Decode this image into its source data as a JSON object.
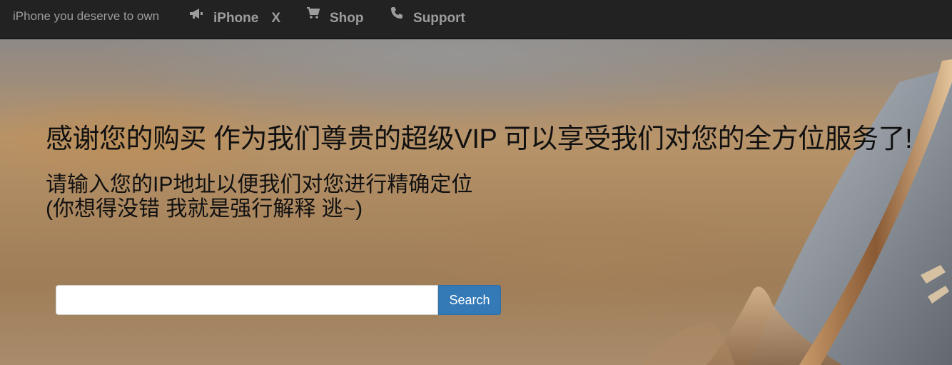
{
  "navbar": {
    "brand": "iPhone you deserve to own",
    "items": [
      {
        "icon": "megaphone-icon",
        "label": "iPhone",
        "label_suffix": "X"
      },
      {
        "icon": "shopping-cart-icon",
        "label": "Shop"
      },
      {
        "icon": "phone-icon",
        "label": "Support"
      }
    ],
    "text_color": "#9d9d9d",
    "background": "#222222"
  },
  "hero": {
    "title": "感谢您的购买 作为我们尊贵的超级VIP 可以享受我们对您的全方位服务了!",
    "subtitle_line1": "请输入您的IP地址以便我们对您进行精确定位",
    "subtitle_line2": "(你想得没错 我就是强行解释 逃~)"
  },
  "search": {
    "value": "",
    "placeholder": "",
    "button_label": "Search",
    "button_color": "#337ab7"
  }
}
